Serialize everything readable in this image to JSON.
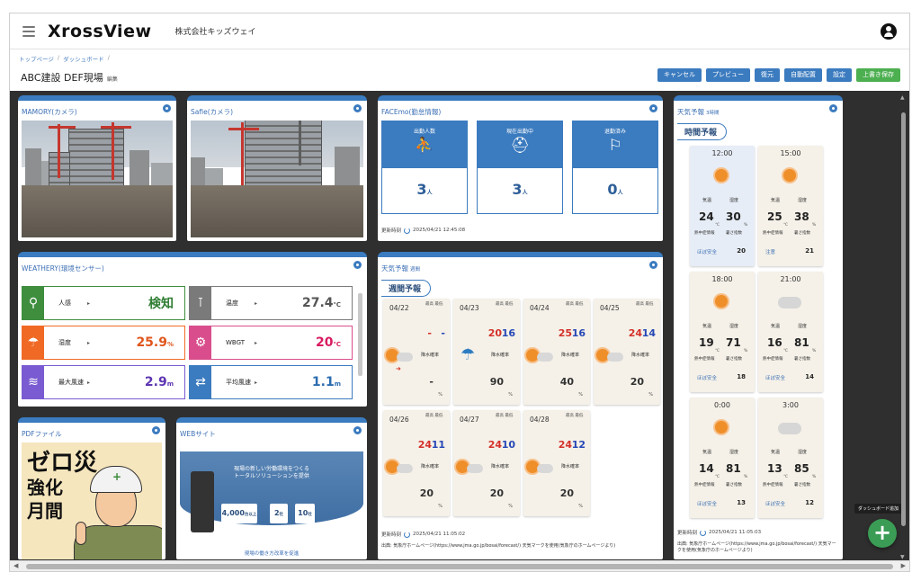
{
  "header": {
    "logo": "XrossView",
    "company": "株式会社キッズウェイ"
  },
  "breadcrumb": [
    "トップページ",
    "ダッシュボード"
  ],
  "page": {
    "title": "ABC建設 DEF現場",
    "edit_label": "編集"
  },
  "actions": {
    "cancel": "キャンセル",
    "preview": "プレビュー",
    "restore": "復元",
    "auto_layout": "自動配置",
    "settings": "設定",
    "overwrite_save": "上書き保存"
  },
  "widgets": {
    "mamory": {
      "title": "MAMORY(カメラ)"
    },
    "safie": {
      "title": "Safie(カメラ)"
    },
    "facemo": {
      "title": "FACEmo(勤怠情報)",
      "boxes": [
        {
          "label": "出勤人数",
          "value": "3",
          "unit": "人"
        },
        {
          "label": "現在出勤中",
          "value": "3",
          "unit": "人"
        },
        {
          "label": "退勤済み",
          "value": "0",
          "unit": "人"
        }
      ],
      "updated_label": "更新時刻",
      "updated_time": "2025/04/21 12:45:08"
    },
    "weathery": {
      "title": "WEATHERY(環境センサー)",
      "sensors": [
        {
          "name": "人感",
          "value": "検知",
          "unit": "",
          "color": "#3e8e3e"
        },
        {
          "name": "温度",
          "value": "27.4",
          "unit": "℃",
          "color": "#7a7a7a"
        },
        {
          "name": "湿度",
          "value": "25.9",
          "unit": "%",
          "color": "#f06a25"
        },
        {
          "name": "WBGT",
          "value": "20",
          "unit": "℃",
          "color": "#d94d8c"
        },
        {
          "name": "最大風速",
          "value": "2.9",
          "unit": "m",
          "color": "#7a5bd1"
        },
        {
          "name": "平均風速",
          "value": "1.1",
          "unit": "m",
          "color": "#3b7bbf"
        }
      ]
    },
    "weekly": {
      "title": "天気予報",
      "subtitle": "週間",
      "tab": "週間予報",
      "high_low_label": "最高 最低",
      "rain_label": "降水確率",
      "days": [
        {
          "date": "04/22",
          "high": "-",
          "low": "-",
          "rain": "-",
          "icon": "sun-cloud"
        },
        {
          "date": "04/23",
          "high": "20",
          "low": "16",
          "rain": "90",
          "icon": "umbrella"
        },
        {
          "date": "04/24",
          "high": "25",
          "low": "16",
          "rain": "40",
          "icon": "sun-cloud"
        },
        {
          "date": "04/25",
          "high": "24",
          "low": "14",
          "rain": "20",
          "icon": "sun-cloud"
        },
        {
          "date": "04/26",
          "high": "24",
          "low": "11",
          "rain": "20",
          "icon": "sun-cloud"
        },
        {
          "date": "04/27",
          "high": "24",
          "low": "10",
          "rain": "20",
          "icon": "sun-cloud"
        },
        {
          "date": "04/28",
          "high": "24",
          "low": "12",
          "rain": "20",
          "icon": "sun-cloud"
        }
      ],
      "pct": "%",
      "updated_label": "更新時刻",
      "updated_time": "2025/04/21 11:05:02",
      "source": "出典: 気象庁ホームページ(https://www.jma.go.jp/bosai/forecast/) 天気マークを使用(気象庁のホームページより)"
    },
    "hourly": {
      "title": "天気予報",
      "subtitle": "3時間",
      "tab": "時間予報",
      "temp_label": "気温",
      "humidity_label": "湿度",
      "heat_label": "熱中症情報",
      "heat_index_label": "暑さ指数",
      "slots": [
        {
          "time": "12:00",
          "temp": "24",
          "hum": "30",
          "level": "ほぼ安全",
          "index": "20",
          "icon": "sun"
        },
        {
          "time": "15:00",
          "temp": "25",
          "hum": "38",
          "level": "注意",
          "index": "21",
          "icon": "sun"
        },
        {
          "time": "18:00",
          "temp": "19",
          "hum": "71",
          "level": "ほぼ安全",
          "index": "18",
          "icon": "sun"
        },
        {
          "time": "21:00",
          "temp": "16",
          "hum": "81",
          "level": "ほぼ安全",
          "index": "14",
          "icon": "cloud"
        },
        {
          "time": "0:00",
          "temp": "14",
          "hum": "81",
          "level": "ほぼ安全",
          "index": "13",
          "icon": "sun"
        },
        {
          "time": "3:00",
          "temp": "13",
          "hum": "85",
          "level": "ほぼ安全",
          "index": "12",
          "icon": "cloud"
        }
      ],
      "updated_label": "更新時刻",
      "updated_time": "2025/04/21 11:05:03",
      "source": "出典: 気象庁ホームページ(https://www.jma.go.jp/bosai/forecast/) 天気マークを使用(気象庁のホームページより)"
    },
    "pdf": {
      "title": "PDFファイル",
      "poster_lines": [
        "ゼロ災",
        "強化",
        "月間"
      ]
    },
    "website": {
      "title": "WEBサイト",
      "hero_line1": "現場の新しい労働環境をつくる",
      "hero_line2": "トータルソリューションを提供",
      "stats": [
        {
          "value": "4,000",
          "unit": "台以上"
        },
        {
          "value": "2",
          "unit": "社"
        },
        {
          "value": "10",
          "unit": "社"
        }
      ],
      "link": "現場の働き方改革を促進"
    }
  },
  "fab": {
    "tooltip": "ダッシュボード追加"
  }
}
